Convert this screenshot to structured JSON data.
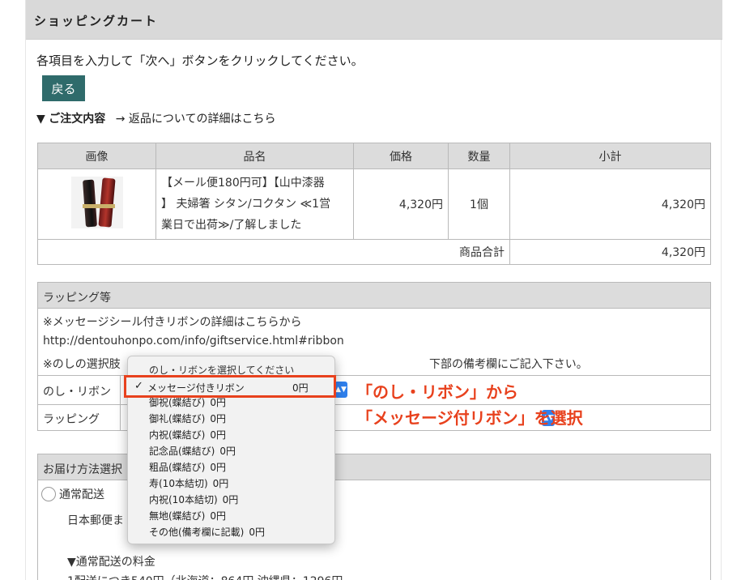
{
  "header": {
    "title": "ショッピングカート"
  },
  "instruction": "各項目を入力して「次へ」ボタンをクリックしてください。",
  "back_button": "戻る",
  "order_section": {
    "marker": "▼",
    "title": "ご注文内容",
    "returns_link": "→ 返品についての詳細はこちら"
  },
  "order_table": {
    "headers": [
      "画像",
      "品名",
      "価格",
      "数量",
      "小計"
    ],
    "item": {
      "name_line1": "【メール便180円可】【山中漆器",
      "name_line2": "】 夫婦箸 シタン/コクタン ≪1営",
      "name_line3": "業日で出荷≫/了解しました",
      "price": "4,320円",
      "quantity": "1個",
      "subtotal": "4,320円"
    },
    "total_label": "商品合計",
    "total_value": "4,320円"
  },
  "wrapping": {
    "title": "ラッピング等",
    "note1": "※メッセージシール付きリボンの詳細はこちらから",
    "url": "http://dentouhonpo.com/info/giftservice.html#ribbon",
    "note2_start": "※のしの選択肢",
    "note2_end": "下部の備考欄にご記入下さい。",
    "noshi_label": "のし・リボン",
    "wrap_label": "ラッピング"
  },
  "delivery": {
    "title_partial": "お届け方法選択",
    "option_normal": "通常配送",
    "option_detail_partial": "日本郵便ま",
    "fee_heading": "▼通常配送の料金",
    "fee_detail_partial": "1配送につき540円（北海道：864円 沖縄県：1296円"
  },
  "dropdown": {
    "placeholder": "のし・リボンを選択してください",
    "selected_check": "✓",
    "selected_label": "メッセージ付きリボン",
    "selected_price": "0円",
    "options": [
      {
        "label": "御祝(蝶結び)",
        "price": "0円"
      },
      {
        "label": "御礼(蝶結び)",
        "price": "0円"
      },
      {
        "label": "内祝(蝶結び)",
        "price": "0円"
      },
      {
        "label": "記念品(蝶結び)",
        "price": "0円"
      },
      {
        "label": "粗品(蝶結び)",
        "price": "0円"
      },
      {
        "label": "寿(10本結切)",
        "price": "0円"
      },
      {
        "label": "内祝(10本結切)",
        "price": "0円"
      },
      {
        "label": "無地(蝶結び)",
        "price": "0円"
      },
      {
        "label": "その他(備考欄に記載)",
        "price": "0円"
      }
    ]
  },
  "annotation": {
    "line1": "「のし・リボン」から",
    "line2": "「メッセージ付リボン」を選択",
    "color": "#e8411d"
  },
  "colors": {
    "back_button": "#2f6b6b",
    "header_bg": "#d9d9d9",
    "select_arrow": "#2f80ed"
  }
}
